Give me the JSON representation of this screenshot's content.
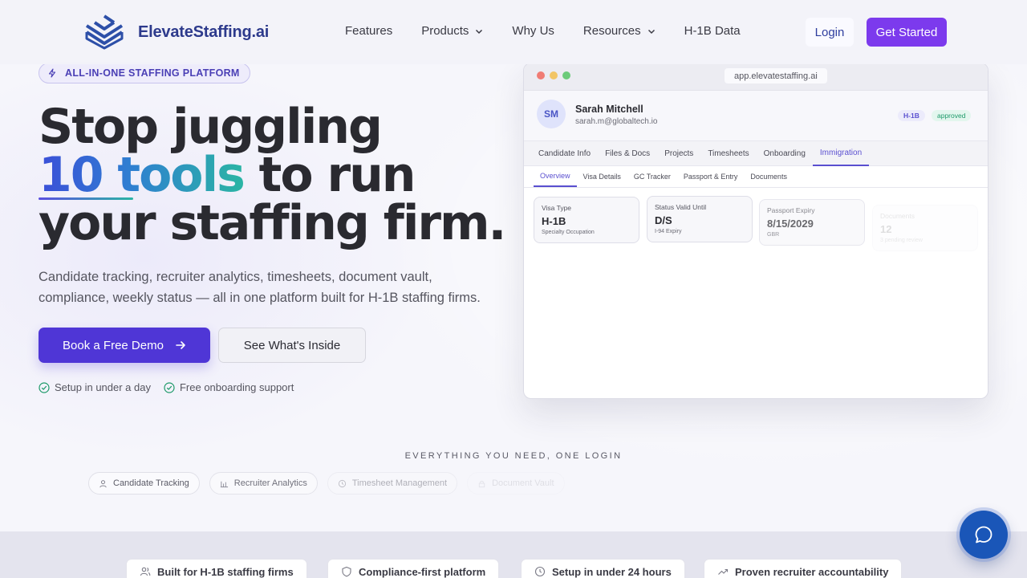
{
  "brand": {
    "name": "ElevateStaffing.ai"
  },
  "nav": {
    "links": [
      {
        "label": "Features",
        "dropdown": false
      },
      {
        "label": "Products",
        "dropdown": true
      },
      {
        "label": "Why Us",
        "dropdown": false
      },
      {
        "label": "Resources",
        "dropdown": true
      },
      {
        "label": "H-1B Data",
        "dropdown": false
      }
    ],
    "login": "Login",
    "get_started": "Get Started"
  },
  "hero": {
    "badge": "ALL-IN-ONE STAFFING PLATFORM",
    "title_line1": "Stop juggling",
    "title_highlight": "10 tools",
    "title_line2_rest": " to run",
    "title_line3": "your staffing firm.",
    "subtitle": "Candidate tracking, recruiter analytics, timesheets, document vault, compliance, weekly status — all in one platform built for H-1B staffing firms.",
    "cta_primary": "Book a Free Demo",
    "cta_secondary": "See What's Inside",
    "checks": [
      "Setup in under a day",
      "Free onboarding support"
    ]
  },
  "mockup": {
    "url": "app.elevatestaffing.ai",
    "profile": {
      "initials": "SM",
      "name": "Sarah Mitchell",
      "email": "sarah.m@globaltech.io",
      "tags": [
        "H-1B",
        "approved"
      ]
    },
    "tabs": [
      "Candidate Info",
      "Files & Docs",
      "Projects",
      "Timesheets",
      "Onboarding",
      "Immigration"
    ],
    "active_tab": "Immigration",
    "subtabs": [
      "Overview",
      "Visa Details",
      "GC Tracker",
      "Passport & Entry",
      "Documents"
    ],
    "active_subtab": "Overview",
    "cards": [
      {
        "label": "Visa Type",
        "value": "H-1B",
        "note": "Specialty Occupation"
      },
      {
        "label": "Status Valid Until",
        "value": "D/S",
        "note": "I-94 Expiry"
      },
      {
        "label": "Passport Expiry",
        "value": "8/15/2029",
        "note": "GBR"
      },
      {
        "label": "Documents",
        "value": "12",
        "note": "3 pending review"
      }
    ]
  },
  "everything": {
    "heading": "EVERYTHING YOU NEED, ONE LOGIN",
    "pills": [
      "Candidate Tracking",
      "Recruiter Analytics",
      "Timesheet Management",
      "Document Vault"
    ]
  },
  "features": [
    {
      "label": "Built for H-1B staffing firms",
      "icon": "users-icon"
    },
    {
      "label": "Compliance-first platform",
      "icon": "shield-icon"
    },
    {
      "label": "Setup in under 24 hours",
      "icon": "clock-icon"
    },
    {
      "label": "Proven recruiter accountability",
      "icon": "trend-icon"
    }
  ],
  "colors": {
    "brand_purple": "#7c3aed",
    "primary_button": "#4f36d6",
    "chat_button": "#1a56b8",
    "check_green": "#1e9a6a"
  }
}
